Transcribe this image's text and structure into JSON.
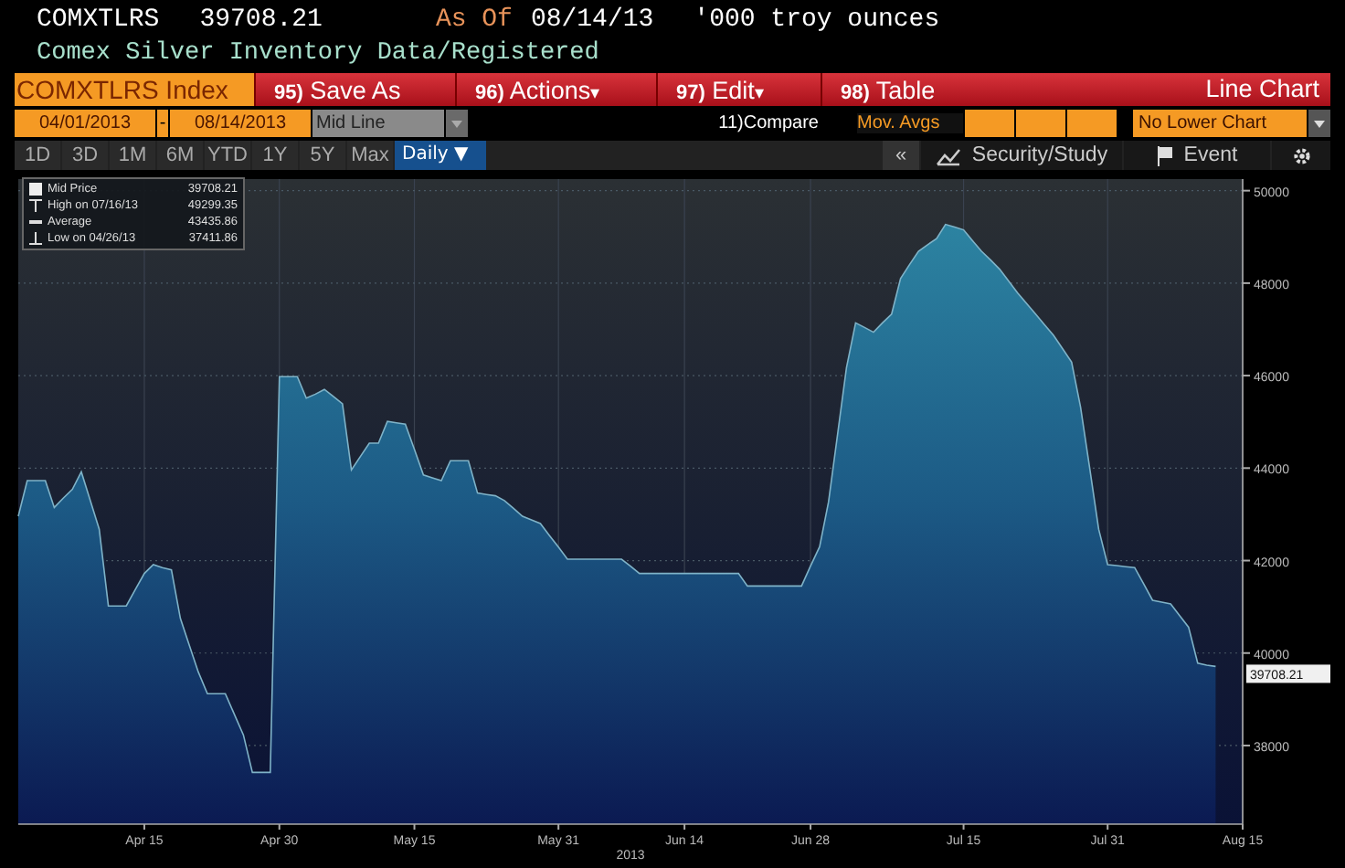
{
  "header": {
    "ticker": "COMXTLRS",
    "value": "39708.21",
    "as_of": "As Of",
    "date": "08/14/13",
    "units": "'000 troy ounces"
  },
  "subtitle": "Comex Silver Inventory Data/Registered",
  "toolbar": {
    "security": "COMXTLRS Index",
    "buttons": [
      {
        "number": "95)",
        "label": "Save As"
      },
      {
        "number": "96)",
        "label": "Actions",
        "caret": "▾"
      },
      {
        "number": "97)",
        "label": "Edit",
        "caret": "▾"
      },
      {
        "number": "98)",
        "label": "Table"
      }
    ],
    "chart_type": "Line Chart"
  },
  "controls": {
    "start_date": "04/01/2013",
    "separator": "-",
    "end_date": "08/14/2013",
    "style": "Mid Line",
    "compare": "11)Compare",
    "mov_avgs": "Mov. Avgs",
    "lower_chart": "No Lower Chart"
  },
  "periods": [
    {
      "label": "1D",
      "selected": false
    },
    {
      "label": "3D",
      "selected": false
    },
    {
      "label": "1M",
      "selected": false
    },
    {
      "label": "6M",
      "selected": false
    },
    {
      "label": "YTD",
      "selected": false
    },
    {
      "label": "1Y",
      "selected": false
    },
    {
      "label": "5Y",
      "selected": false
    },
    {
      "label": "Max",
      "selected": false
    }
  ],
  "frequency": {
    "label": "Daily",
    "caret": "▼"
  },
  "right_tools": {
    "collapse": "«",
    "security_study": "Security/Study",
    "event": "Event"
  },
  "legend": [
    {
      "kind": "price",
      "value": "39708.21"
    },
    {
      "kind": "high",
      "label": "High on 07/16/13",
      "value": "49299.35"
    },
    {
      "kind": "average",
      "label": "Average",
      "value": "43435.86"
    },
    {
      "kind": "low",
      "label": "Low on 04/26/13",
      "value": "37411.86"
    }
  ],
  "last_price_label": "39708.21",
  "chart_data": {
    "type": "area",
    "xlabel": "2013",
    "categories": [
      null,
      null,
      null,
      null,
      null,
      null,
      null,
      null,
      null,
      null,
      null,
      null,
      null,
      null,
      "Apr 15",
      null,
      null,
      null,
      null,
      null,
      null,
      null,
      null,
      null,
      null,
      null,
      null,
      null,
      null,
      "Apr 30",
      null,
      null,
      null,
      null,
      null,
      null,
      null,
      null,
      null,
      null,
      null,
      null,
      null,
      null,
      "May 15",
      null,
      null,
      null,
      null,
      null,
      null,
      null,
      null,
      null,
      null,
      null,
      null,
      null,
      null,
      null,
      "May 31",
      null,
      null,
      null,
      null,
      null,
      null,
      null,
      null,
      null,
      null,
      null,
      null,
      null,
      "Jun 14",
      null,
      null,
      null,
      null,
      null,
      null,
      null,
      null,
      null,
      null,
      null,
      null,
      null,
      "Jun 28",
      null,
      null,
      null,
      null,
      null,
      null,
      null,
      null,
      null,
      null,
      null,
      null,
      null,
      null,
      null,
      null,
      "Jul 15",
      null,
      null,
      null,
      null,
      null,
      null,
      null,
      null,
      null,
      null,
      null,
      null,
      null,
      null,
      null,
      "Jul 31",
      null,
      null,
      null,
      null,
      null,
      null,
      null,
      null,
      null,
      null,
      null,
      null,
      null,
      null,
      "Aug 15"
    ],
    "series": [
      {
        "name": "Mid Price",
        "color": "#2f8aa6",
        "values": [
          42960,
          43730,
          43730,
          43730,
          43150,
          43350,
          43540,
          43920,
          43300,
          42680,
          41020,
          41020,
          41020,
          41370,
          41720,
          41910,
          41850,
          41800,
          40750,
          40170,
          39590,
          39120,
          39120,
          39120,
          38680,
          38230,
          37420,
          37420,
          37420,
          45980,
          45980,
          45980,
          45510,
          45600,
          45700,
          45550,
          45390,
          43960,
          44250,
          44540,
          44540,
          45010,
          44980,
          44950,
          44400,
          43850,
          43790,
          43730,
          44160,
          44160,
          44160,
          43460,
          43430,
          43400,
          43300,
          43130,
          42960,
          42880,
          42800,
          42540,
          42290,
          42030,
          42030,
          42030,
          42030,
          42030,
          42030,
          42030,
          41880,
          41720,
          41720,
          41720,
          41720,
          41720,
          41720,
          41720,
          41720,
          41720,
          41720,
          41720,
          41720,
          41450,
          41450,
          41450,
          41450,
          41450,
          41450,
          41450,
          41880,
          42300,
          43270,
          44720,
          46170,
          47140,
          47040,
          46940,
          47140,
          47330,
          48100,
          48400,
          48690,
          48830,
          48960,
          49270,
          49210,
          49150,
          48920,
          48690,
          48500,
          48300,
          48050,
          47790,
          47560,
          47330,
          47100,
          46870,
          46580,
          46290,
          45320,
          44000,
          42680,
          41910,
          41890,
          41870,
          41850,
          41500,
          41140,
          41100,
          41060,
          40810,
          40560,
          39780,
          39740,
          39710,
          null,
          null,
          null
        ]
      }
    ],
    "ylim": [
      36300,
      50250
    ],
    "grid": true,
    "yticks": [
      38000,
      40000,
      42000,
      44000,
      46000,
      48000,
      50000
    ]
  }
}
